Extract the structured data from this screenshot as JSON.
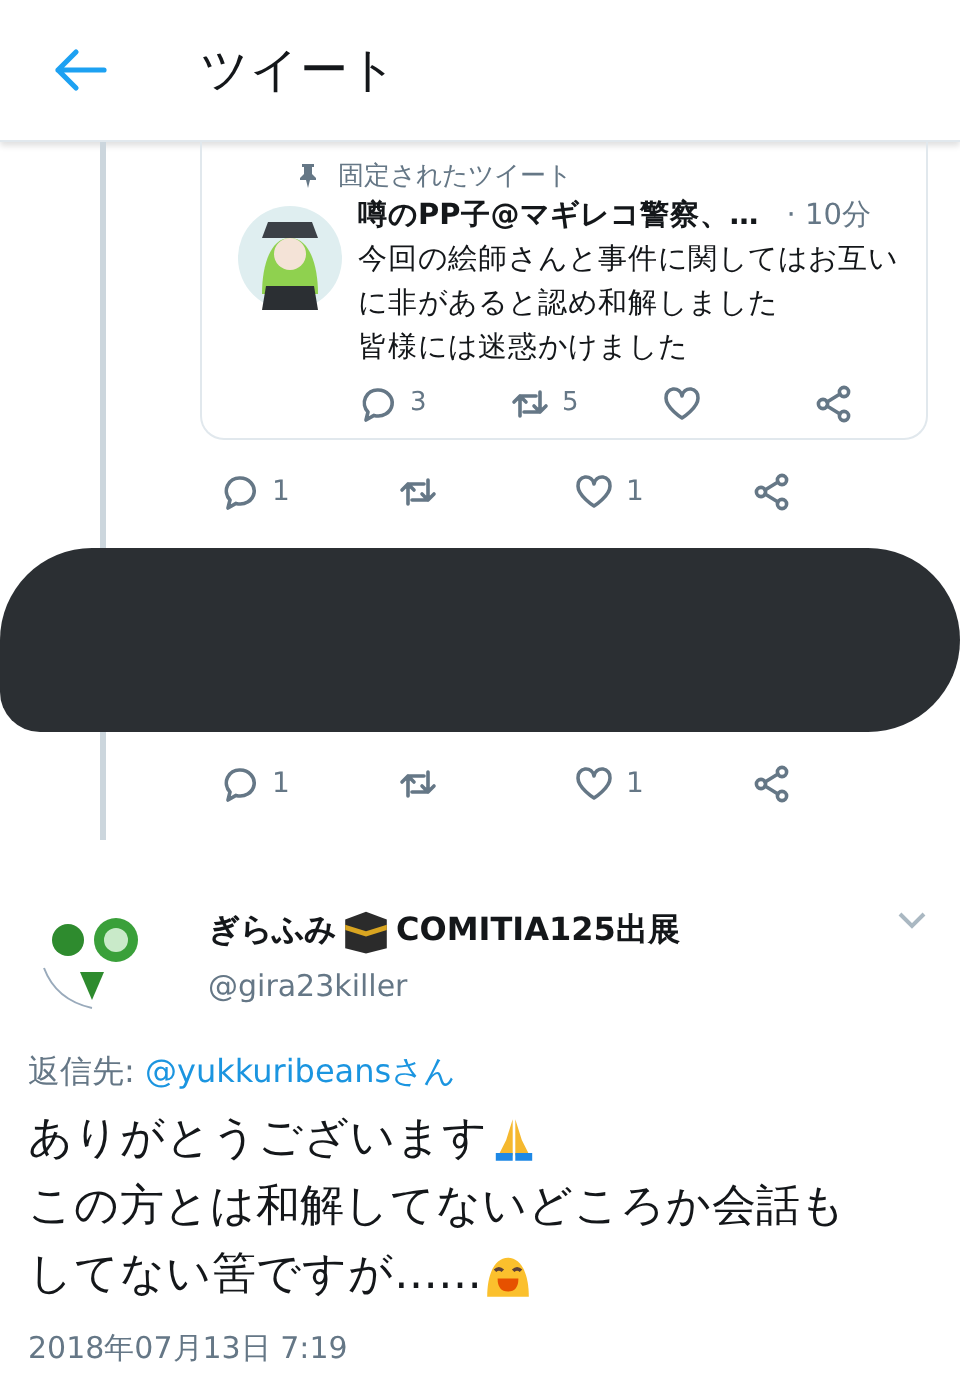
{
  "header": {
    "title": "ツイート"
  },
  "quoted_tweet": {
    "pinned_label": "固定されたツイート",
    "author": "噂のPP子@マギレコ警察、…",
    "time": "· 10分",
    "lines": [
      "今回の絵師さんと事件に関してはお互い",
      "に非があると認め和解しました",
      "皆様には迷惑かけました"
    ],
    "replies": "3",
    "retweets": "5"
  },
  "action_rows": [
    {
      "replies": "1",
      "likes": "1"
    },
    {
      "replies": "1",
      "likes": "1"
    }
  ],
  "tweet": {
    "name_start": "ぎらふみ",
    "name_end": "COMITIA125出展",
    "handle": "@gira23killer",
    "reply_label": "返信先:",
    "reply_to": "@yukkuribeansさん",
    "lines": [
      "ありがとうございます",
      "この方とは和解してないどころか会話も",
      "してない筈ですが……"
    ],
    "date": "2018年07月13日 7:19"
  }
}
